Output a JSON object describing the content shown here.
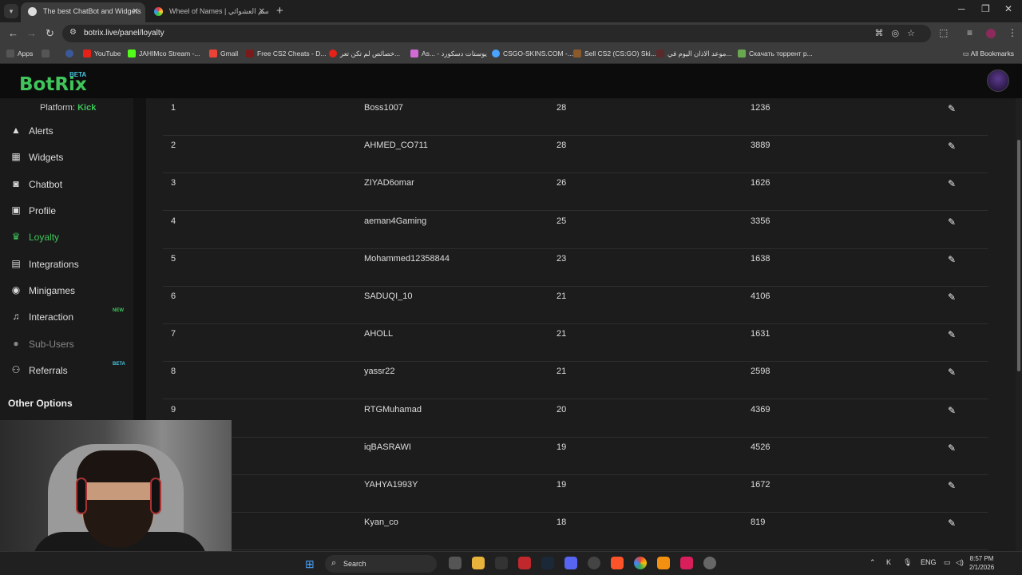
{
  "browser": {
    "tabs": [
      {
        "title": "The best ChatBot and Widgets",
        "active": true
      },
      {
        "title": "Wheel of Names | سم العشوائي",
        "active": false
      }
    ],
    "url": "botrix.live/panel/loyalty",
    "bookmarks": [
      {
        "label": "Apps",
        "color": "#888888"
      },
      {
        "label": "",
        "color": "#3b5998"
      },
      {
        "label": "YouTube",
        "color": "#e62117"
      },
      {
        "label": "JAHIMco Stream -...",
        "color": "#53fc18"
      },
      {
        "label": "Gmail",
        "color": "#ea4335"
      },
      {
        "label": "Free CS2 Cheats - D...",
        "color": "#7a1a1a"
      },
      {
        "label": "خصائص لم تكن تعر...",
        "color": "#e62117"
      },
      {
        "label": "As... - يوستات دسكورد",
        "color": "#d26ad6"
      },
      {
        "label": "CSGO-SKINS.COM -...",
        "color": "#4aa3ff"
      },
      {
        "label": "Sell CS2 (CS:GO) Ski...",
        "color": "#8b5a2b"
      },
      {
        "label": "موعد الاذان اليوم في...",
        "color": "#5a2a2a"
      },
      {
        "label": "Скачать торрент р...",
        "color": "#6aa84f"
      }
    ],
    "all_bookmarks": "All Bookmarks"
  },
  "app": {
    "logo": "BotRix",
    "logo_badge": "BETA",
    "platform_label": "Platform:",
    "platform_value": "Kick",
    "accent": "#3fc55a"
  },
  "sidebar": {
    "items": [
      {
        "label": "Alerts",
        "icon": "warning-icon",
        "glyph": "▲",
        "state": "normal"
      },
      {
        "label": "Widgets",
        "icon": "widgets-icon",
        "glyph": "▦",
        "state": "normal"
      },
      {
        "label": "Chatbot",
        "icon": "robot-icon",
        "glyph": "◙",
        "state": "normal"
      },
      {
        "label": "Profile",
        "icon": "id-card-icon",
        "glyph": "▣",
        "state": "normal"
      },
      {
        "label": "Loyalty",
        "icon": "trophy-icon",
        "glyph": "♛",
        "state": "active"
      },
      {
        "label": "Integrations",
        "icon": "integrations-icon",
        "glyph": "▤",
        "state": "normal"
      },
      {
        "label": "Minigames",
        "icon": "gamepad-icon",
        "glyph": "◉",
        "state": "normal"
      },
      {
        "label": "Interaction",
        "icon": "music-icon",
        "glyph": "♫",
        "state": "normal",
        "badge": "NEW",
        "badge_color": "#3fc55a"
      },
      {
        "label": "Sub-Users",
        "icon": "users-icon",
        "glyph": "●",
        "state": "disabled"
      },
      {
        "label": "Referrals",
        "icon": "referrals-icon",
        "glyph": "⚇",
        "state": "normal",
        "badge": "BETA",
        "badge_color": "#44c3dd"
      }
    ],
    "other_options": "Other Options"
  },
  "leaderboard": {
    "rows": [
      {
        "rank": "1",
        "user": "Boss1007",
        "level": "28",
        "points": "1236"
      },
      {
        "rank": "2",
        "user": "AHMED_CO711",
        "level": "28",
        "points": "3889"
      },
      {
        "rank": "3",
        "user": "ZIYAD6omar",
        "level": "26",
        "points": "1626"
      },
      {
        "rank": "4",
        "user": "aeman4Gaming",
        "level": "25",
        "points": "3356"
      },
      {
        "rank": "5",
        "user": "Mohammed12358844",
        "level": "23",
        "points": "1638"
      },
      {
        "rank": "6",
        "user": "SADUQI_10",
        "level": "21",
        "points": "4106"
      },
      {
        "rank": "7",
        "user": "AHOLL",
        "level": "21",
        "points": "1631"
      },
      {
        "rank": "8",
        "user": "yassr22",
        "level": "21",
        "points": "2598"
      },
      {
        "rank": "9",
        "user": "RTGMuhamad",
        "level": "20",
        "points": "4369"
      },
      {
        "rank": "",
        "user": "iqBASRAWI",
        "level": "19",
        "points": "4526"
      },
      {
        "rank": "",
        "user": "YAHYA1993Y",
        "level": "19",
        "points": "1672"
      },
      {
        "rank": "",
        "user": "Kyan_co",
        "level": "18",
        "points": "819"
      }
    ]
  },
  "taskbar": {
    "search": "Search",
    "lang": "ENG",
    "time": "8:57 PM",
    "date": "2/1/2026"
  }
}
